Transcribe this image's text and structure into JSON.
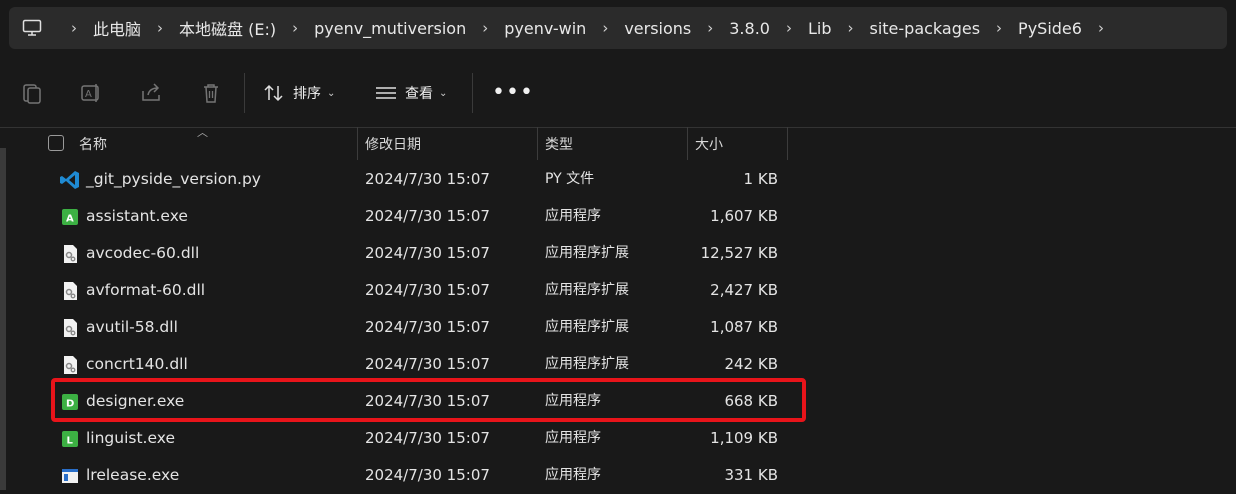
{
  "breadcrumb": [
    "此电脑",
    "本地磁盘 (E:)",
    "pyenv_mutiversion",
    "pyenv-win",
    "versions",
    "3.8.0",
    "Lib",
    "site-packages",
    "PySide6"
  ],
  "toolbar": {
    "icons": [
      "copy-icon",
      "rename-icon",
      "share-icon",
      "delete-icon"
    ],
    "sort_label": "排序",
    "view_label": "查看",
    "more_label": "•••"
  },
  "columns": {
    "name": "名称",
    "date": "修改日期",
    "type": "类型",
    "size": "大小"
  },
  "files": [
    {
      "name": "_git_pyside_version.py",
      "date": "2024/7/30 15:07",
      "type": "PY 文件",
      "size": "1 KB",
      "icon": "vscode-py-icon"
    },
    {
      "name": "assistant.exe",
      "date": "2024/7/30 15:07",
      "type": "应用程序",
      "size": "1,607 KB",
      "icon": "assistant-exe-icon"
    },
    {
      "name": "avcodec-60.dll",
      "date": "2024/7/30 15:07",
      "type": "应用程序扩展",
      "size": "12,527 KB",
      "icon": "dll-icon"
    },
    {
      "name": "avformat-60.dll",
      "date": "2024/7/30 15:07",
      "type": "应用程序扩展",
      "size": "2,427 KB",
      "icon": "dll-icon"
    },
    {
      "name": "avutil-58.dll",
      "date": "2024/7/30 15:07",
      "type": "应用程序扩展",
      "size": "1,087 KB",
      "icon": "dll-icon"
    },
    {
      "name": "concrt140.dll",
      "date": "2024/7/30 15:07",
      "type": "应用程序扩展",
      "size": "242 KB",
      "icon": "dll-icon"
    },
    {
      "name": "designer.exe",
      "date": "2024/7/30 15:07",
      "type": "应用程序",
      "size": "668 KB",
      "icon": "designer-exe-icon"
    },
    {
      "name": "linguist.exe",
      "date": "2024/7/30 15:07",
      "type": "应用程序",
      "size": "1,109 KB",
      "icon": "linguist-exe-icon"
    },
    {
      "name": "lrelease.exe",
      "date": "2024/7/30 15:07",
      "type": "应用程序",
      "size": "331 KB",
      "icon": "window-exe-icon"
    }
  ],
  "highlight_color": "#e8141a",
  "accent_green": "#3cb043"
}
